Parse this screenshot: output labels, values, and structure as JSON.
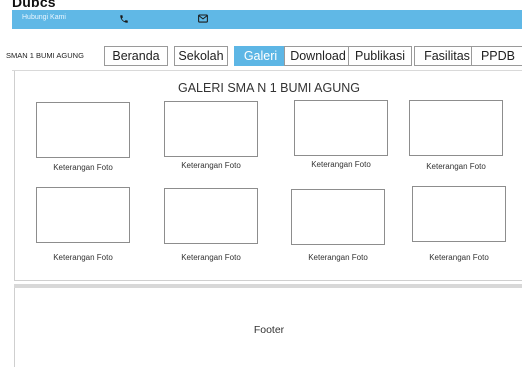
{
  "page_label": "Dubcs",
  "topbar": {
    "contact_label": "Hubungi Kami",
    "phone_icon": "phone-icon",
    "mail_icon": "mail-icon",
    "color": "#60b8e6"
  },
  "navbar": {
    "brand": "SMAN 1 BUMI AGUNG",
    "items": [
      {
        "label": "Beranda",
        "active": false
      },
      {
        "label": "Sekolah",
        "active": false
      },
      {
        "label": "Galeri",
        "active": true
      },
      {
        "label": "Download",
        "active": false
      },
      {
        "label": "Publikasi",
        "active": false
      },
      {
        "label": "Fasilitas",
        "active": false
      },
      {
        "label": "PPDB",
        "active": false
      }
    ],
    "active_color": "#5db6e5"
  },
  "gallery": {
    "title": "GALERI SMA N 1 BUMI AGUNG",
    "photos": [
      {
        "caption": "Keterangan Foto"
      },
      {
        "caption": "Keterangan Foto"
      },
      {
        "caption": "Keterangan Foto"
      },
      {
        "caption": "Keterangan Foto"
      },
      {
        "caption": "Keterangan Foto"
      },
      {
        "caption": "Keterangan Foto"
      },
      {
        "caption": "Keterangan Foto"
      },
      {
        "caption": "Keterangan Foto"
      }
    ]
  },
  "footer": {
    "text": "Footer"
  }
}
